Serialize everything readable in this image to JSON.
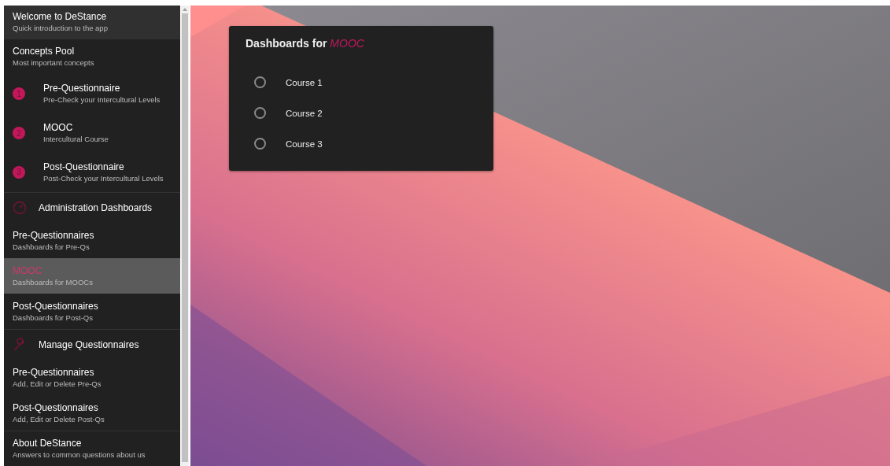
{
  "sidebar": {
    "items": [
      {
        "kind": "header",
        "title": "Welcome to DeStance",
        "subtitle": "Quick introduction to the app",
        "selected": false,
        "divider": false
      },
      {
        "kind": "entry",
        "title": "Concepts Pool",
        "subtitle": "Most important concepts",
        "selected": false,
        "divider": false
      },
      {
        "kind": "step",
        "number": "1",
        "title": "Pre-Questionnaire",
        "subtitle": "Pre-Check your Intercultural Levels",
        "selected": false,
        "divider": false
      },
      {
        "kind": "step",
        "number": "2",
        "title": "MOOC",
        "subtitle": "Intercultural Course",
        "selected": false,
        "divider": false
      },
      {
        "kind": "step",
        "number": "3",
        "title": "Post-Questionnaire",
        "subtitle": "Post-Check your Intercultural Levels",
        "selected": false,
        "divider": false
      },
      {
        "kind": "section",
        "title": "Administration Dashboards",
        "selected": false,
        "divider": true
      },
      {
        "kind": "entry",
        "title": "Pre-Questionnaires",
        "subtitle": "Dashboards for Pre-Qs",
        "selected": false,
        "divider": false
      },
      {
        "kind": "entry",
        "title": "MOOC",
        "subtitle": "Dashboards for MOOCs",
        "selected": true,
        "divider": false
      },
      {
        "kind": "entry",
        "title": "Post-Questionnaires",
        "subtitle": "Dashboards for Post-Qs",
        "selected": false,
        "divider": false
      },
      {
        "kind": "section",
        "title": "Manage Questionnaires",
        "selected": false,
        "divider": true
      },
      {
        "kind": "entry",
        "title": "Pre-Questionnaires",
        "subtitle": "Add, Edit or Delete Pre-Qs",
        "selected": false,
        "divider": false
      },
      {
        "kind": "entry",
        "title": "Post-Questionnaires",
        "subtitle": "Add, Edit or Delete Post-Qs",
        "selected": false,
        "divider": false
      },
      {
        "kind": "entry",
        "title": "About DeStance",
        "subtitle": "Answers to common questions about us",
        "selected": false,
        "divider": true
      }
    ]
  },
  "card": {
    "title": "Dashboards for *MOOC*",
    "options": [
      {
        "label": "Course 1",
        "selected": false
      },
      {
        "label": "Course 2",
        "selected": false
      },
      {
        "label": "Course 3",
        "selected": false
      }
    ]
  }
}
